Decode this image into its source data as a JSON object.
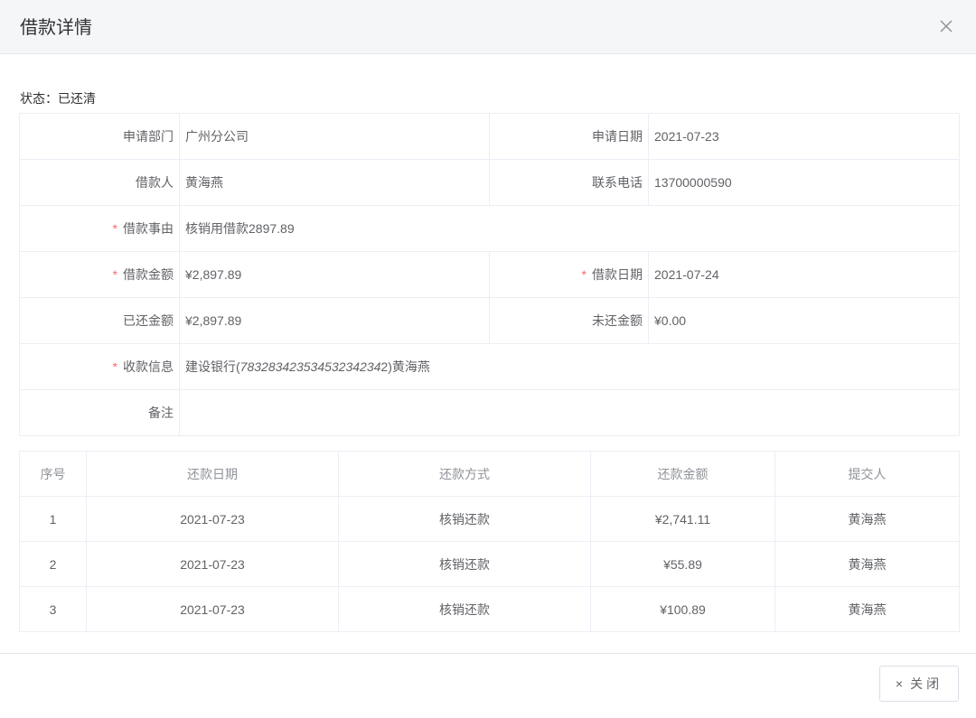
{
  "dialog": {
    "title": "借款详情",
    "close_icon": "close-icon"
  },
  "status": {
    "text": "状态：已还清"
  },
  "info": {
    "dept_label": "申请部门",
    "dept_value": "广州分公司",
    "apply_date_label": "申请日期",
    "apply_date_value": "2021-07-23",
    "borrower_label": "借款人",
    "borrower_value": "黄海燕",
    "phone_label": "联系电话",
    "phone_value": "13700000590",
    "reason_label": "借款事由",
    "reason_value": "核销用借款2897.89",
    "amount_label": "借款金额",
    "amount_value": "¥2,897.89",
    "loan_date_label": "借款日期",
    "loan_date_value": "2021-07-24",
    "repaid_label": "已还金额",
    "repaid_value": "¥2,897.89",
    "unpaid_label": "未还金额",
    "unpaid_value": "¥0.00",
    "receipt_label": "收款信息",
    "receipt_bank": "建设银行(",
    "receipt_account": "78328342353453234234",
    "receipt_rest": "2)黄海燕",
    "remark_label": "备注",
    "remark_value": "",
    "required_mark": "*"
  },
  "payments": {
    "headers": [
      "序号",
      "还款日期",
      "还款方式",
      "还款金额",
      "提交人"
    ],
    "rows": [
      [
        "1",
        "2021-07-23",
        "核销还款",
        "¥2,741.11",
        "黄海燕"
      ],
      [
        "2",
        "2021-07-23",
        "核销还款",
        "¥55.89",
        "黄海燕"
      ],
      [
        "3",
        "2021-07-23",
        "核销还款",
        "¥100.89",
        "黄海燕"
      ]
    ]
  },
  "footer": {
    "close_button_icon": "×",
    "close_button_label": "关闭"
  },
  "colors": {
    "required": "#f56c6c",
    "border": "#ebeef5",
    "header_bg": "#f5f6f8"
  }
}
